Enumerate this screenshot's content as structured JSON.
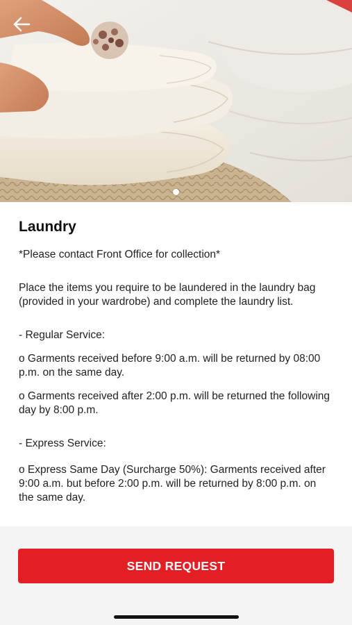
{
  "header": {
    "back_icon": "arrow-left-icon",
    "carousel": {
      "total": 1,
      "active": 1
    }
  },
  "content": {
    "title": "Laundry",
    "note": "*Please contact Front Office for collection*",
    "intro": "Place the items you require to be laundered in the laundry bag (provided in your wardrobe) and complete the laundry list.",
    "regular_heading": "- Regular Service:",
    "regular_item_1": "o   Garments received before 9:00 a.m. will be returned by 08:00 p.m. on the same day.",
    "regular_item_2": "o   Garments received after 2:00 p.m. will be returned the following day by 8:00 p.m.",
    "express_heading": "- Express Service:",
    "express_item_1": "o   Express Same Day (Surcharge 50%): Garments received after 9:00 a.m. but before 2:00 p.m. will be returned by 8:00 p.m. on the same day."
  },
  "footer": {
    "send_label": "SEND REQUEST"
  },
  "colors": {
    "accent": "#e31e24",
    "background": "#f4f4f5",
    "card": "#ffffff"
  }
}
